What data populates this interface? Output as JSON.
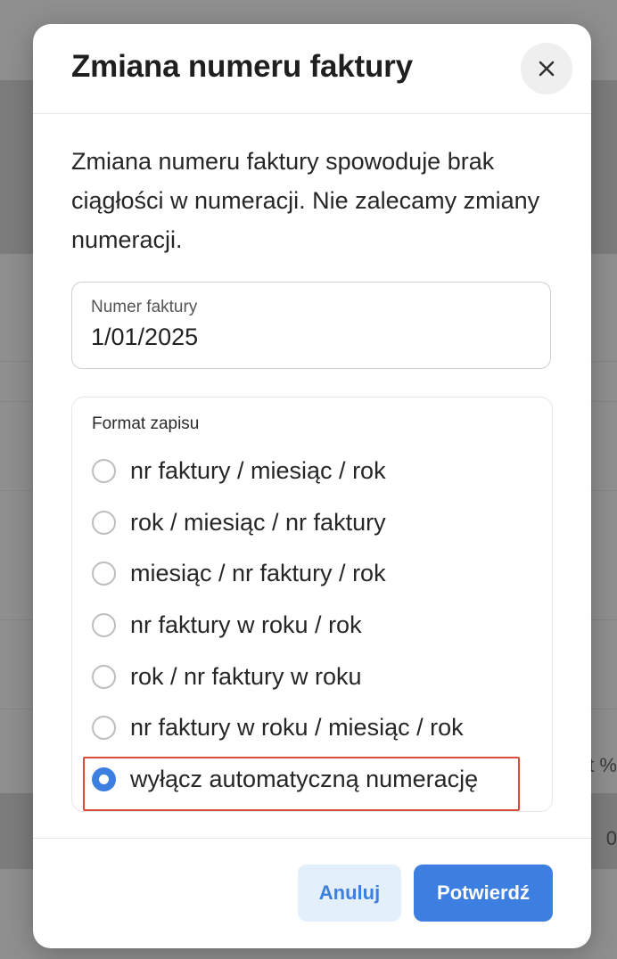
{
  "background": {
    "edge_text_1": "t %",
    "edge_text_2": "0"
  },
  "modal": {
    "title": "Zmiana numeru faktury",
    "close_icon": "close-icon",
    "description": "Zmiana numeru faktury spowoduje brak ciągłości w numeracji. Nie zalecamy zmiany numeracji.",
    "invoice_field": {
      "label": "Numer faktury",
      "value": "1/01/2025"
    },
    "format": {
      "label": "Format zapisu",
      "options": [
        {
          "label": "nr faktury / miesiąc / rok",
          "checked": false
        },
        {
          "label": "rok / miesiąc / nr faktury",
          "checked": false
        },
        {
          "label": "miesiąc / nr faktury / rok",
          "checked": false
        },
        {
          "label": "nr faktury w roku / rok",
          "checked": false
        },
        {
          "label": "rok / nr faktury w roku",
          "checked": false
        },
        {
          "label": "nr faktury w roku / miesiąc / rok",
          "checked": false
        },
        {
          "label": "wyłącz automatyczną numerację",
          "checked": true
        }
      ]
    },
    "buttons": {
      "cancel": "Anuluj",
      "confirm": "Potwierdź"
    }
  },
  "colors": {
    "accent": "#3d7fe0",
    "accent_light": "#e4effc",
    "highlight": "#d94b3b",
    "overlay": "#8f8f8f"
  }
}
